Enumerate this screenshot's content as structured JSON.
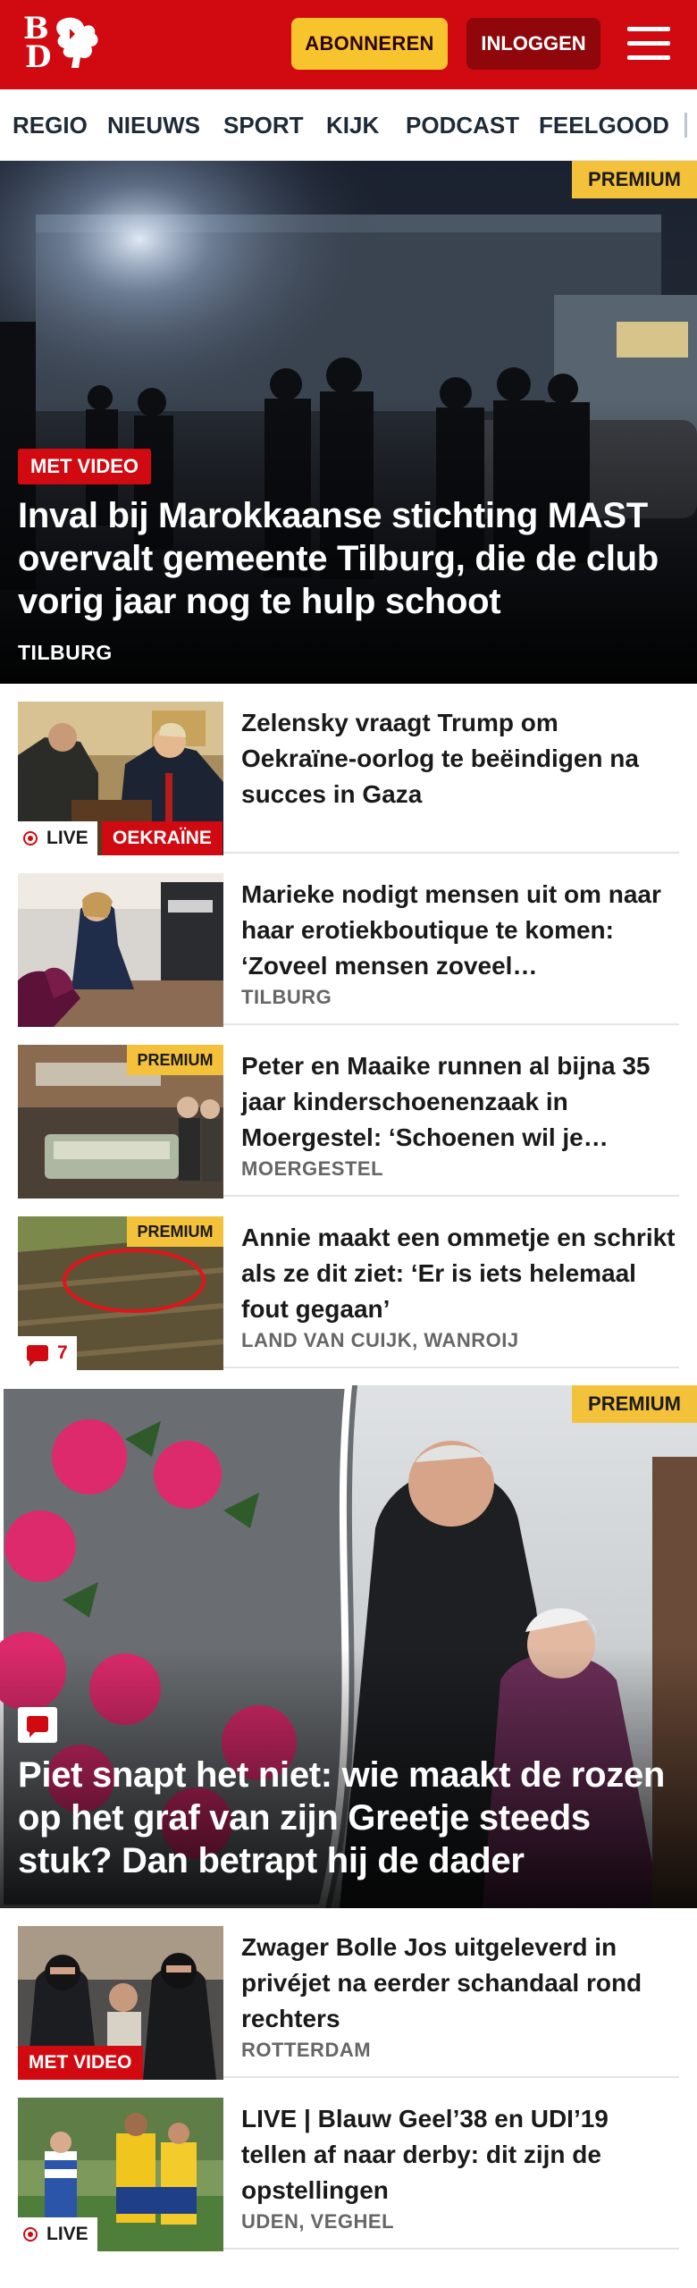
{
  "header": {
    "logo_text": "BD",
    "subscribe_label": "ABONNEREN",
    "login_label": "INLOGGEN",
    "menu_icon": "hamburger-icon"
  },
  "nav": {
    "items": [
      "REGIO",
      "NIEUWS",
      "SPORT",
      "KIJK",
      "PODCAST",
      "FEELGOOD"
    ]
  },
  "hero": {
    "premium_label": "PREMIUM",
    "video_tag": "MET VIDEO",
    "title": "Inval bij Marokkaanse stichting MAST overvalt gemeente Tilburg, die de club vorig jaar nog te hulp schoot",
    "location": "TILBURG"
  },
  "articles": [
    {
      "title": "Zelensky vraagt Trump om Oekraïne-oorlog te beëindigen na succes in Gaza",
      "live_label": "LIVE",
      "category_label": "OEKRAÏNE"
    },
    {
      "title": "Marieke nodigt mensen uit om naar haar erotiekboutique te komen: ‘Zoveel mensen zoveel…",
      "location": "TILBURG"
    },
    {
      "title": "Peter en Maaike runnen al bijna 35 jaar kinderschoenenzaak in Moergestel: ‘Schoenen wil je…",
      "location": "MOERGESTEL",
      "premium_label": "PREMIUM"
    },
    {
      "title": "Annie maakt een ommetje en schrikt als ze dit ziet: ‘Er is iets helemaal fout gegaan’",
      "location": "LAND VAN CUIJK, WANROIJ",
      "premium_label": "PREMIUM",
      "comment_count": "7"
    }
  ],
  "feature": {
    "premium_label": "PREMIUM",
    "title": "Piet snapt het niet: wie maakt de rozen op het graf van zijn Greetje steeds stuk? Dan betrapt hij de dader"
  },
  "articles2": [
    {
      "title": "Zwager Bolle Jos uitgeleverd in privéjet na eerder schandaal rond rechters",
      "location": "ROTTERDAM",
      "video_tag": "MET VIDEO"
    },
    {
      "title": "LIVE | Blauw Geel’38 en UDI’19 tellen af naar derby: dit zijn de opstellingen",
      "location": "UDEN, VEGHEL",
      "live_label": "LIVE"
    }
  ],
  "colors": {
    "brand_red": "#d10a11",
    "subscribe_yellow": "#f8c42d",
    "premium_yellow": "#f4c13a",
    "login_dark_red": "#8f070b"
  }
}
